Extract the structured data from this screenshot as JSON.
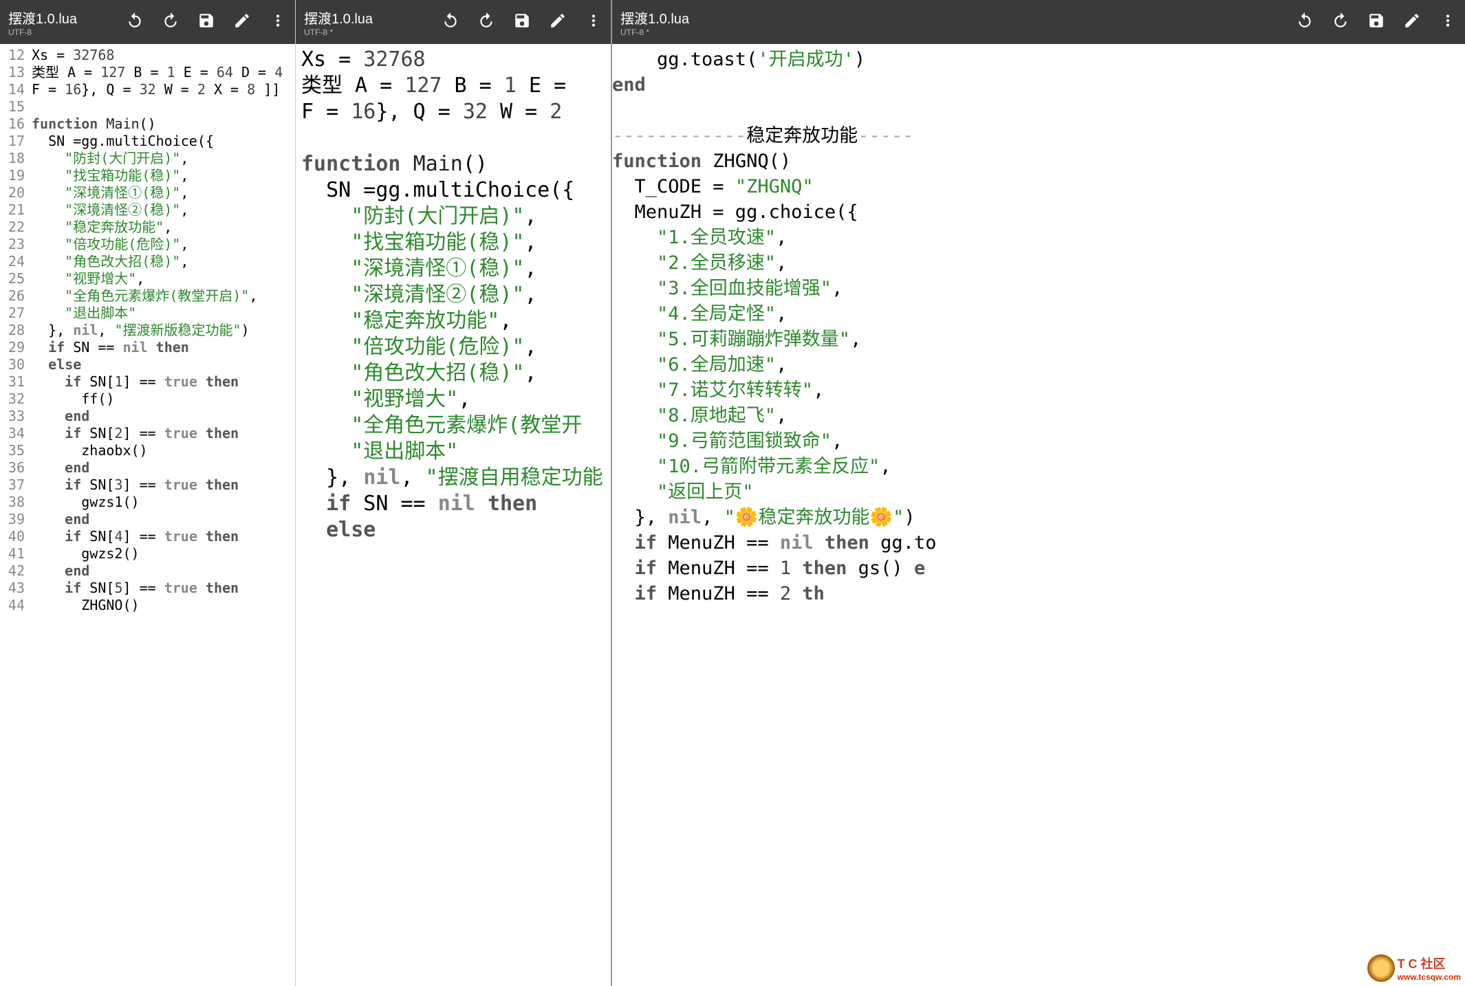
{
  "toolbar1": {
    "filename": "摆渡1.0.lua",
    "encoding": "UTF-8"
  },
  "toolbar2": {
    "filename": "摆渡1.0.lua",
    "encoding": "UTF-8 *"
  },
  "toolbar3": {
    "filename": "摆渡1.0.lua",
    "encoding": "UTF-8 *"
  },
  "pane1": {
    "start": 12,
    "lines": [
      {
        "n": "12",
        "html": "Xs = <span class='num'>32768</span>"
      },
      {
        "n": "13",
        "html": "类型 A = <span class='num'>127</span> B = <span class='num'>1</span> E = <span class='num'>64</span> D = <span class='num'>4</span>"
      },
      {
        "n": "14",
        "html": "F = <span class='num'>16</span>}, Q = <span class='num'>32</span> W = <span class='num'>2</span> X = <span class='num'>8</span> ]]"
      },
      {
        "n": "15",
        "html": ""
      },
      {
        "n": "16",
        "html": "<span class='kw'>function</span> <span class='fn'>Main</span>()"
      },
      {
        "n": "17",
        "html": "  SN =gg.multiChoice({"
      },
      {
        "n": "18",
        "html": "    <span class='str'>\"防封(大门开启)\"</span>,"
      },
      {
        "n": "19",
        "html": "    <span class='str'>\"找宝箱功能(稳)\"</span>,"
      },
      {
        "n": "20",
        "html": "    <span class='str'>\"深境清怪①(稳)\"</span>,"
      },
      {
        "n": "21",
        "html": "    <span class='str'>\"深境清怪②(稳)\"</span>,"
      },
      {
        "n": "22",
        "html": "    <span class='str'>\"稳定奔放功能\"</span>,"
      },
      {
        "n": "23",
        "html": "    <span class='str'>\"倍攻功能(危险)\"</span>,"
      },
      {
        "n": "24",
        "html": "    <span class='str'>\"角色改大招(稳)\"</span>,"
      },
      {
        "n": "25",
        "html": "    <span class='str'>\"视野增大\"</span>,"
      },
      {
        "n": "26",
        "html": "    <span class='str'>\"全角色元素爆炸(教堂开启)\"</span>,"
      },
      {
        "n": "27",
        "html": "    <span class='str'>\"退出脚本\"</span>"
      },
      {
        "n": "28",
        "html": "  }, <span class='nil'>nil</span>, <span class='str'>\"摆渡新版稳定功能\"</span>)"
      },
      {
        "n": "29",
        "html": "  <span class='kw'>if</span> SN == <span class='nil'>nil</span> <span class='kw'>then</span>"
      },
      {
        "n": "30",
        "html": "  <span class='kw'>else</span>"
      },
      {
        "n": "31",
        "html": "    <span class='kw'>if</span> SN[<span class='num'>1</span>] == <span class='bool'>true</span> <span class='kw'>then</span>"
      },
      {
        "n": "32",
        "html": "      ff()"
      },
      {
        "n": "33",
        "html": "    <span class='kw'>end</span>"
      },
      {
        "n": "34",
        "html": "    <span class='kw'>if</span> SN[<span class='num'>2</span>] == <span class='bool'>true</span> <span class='kw'>then</span>"
      },
      {
        "n": "35",
        "html": "      zhaobx()"
      },
      {
        "n": "36",
        "html": "    <span class='kw'>end</span>"
      },
      {
        "n": "37",
        "html": "    <span class='kw'>if</span> SN[<span class='num'>3</span>] == <span class='bool'>true</span> <span class='kw'>then</span>"
      },
      {
        "n": "38",
        "html": "      gwzs1()"
      },
      {
        "n": "39",
        "html": "    <span class='kw'>end</span>"
      },
      {
        "n": "40",
        "html": "    <span class='kw'>if</span> SN[<span class='num'>4</span>] == <span class='bool'>true</span> <span class='kw'>then</span>"
      },
      {
        "n": "41",
        "html": "      gwzs2()"
      },
      {
        "n": "42",
        "html": "    <span class='kw'>end</span>"
      },
      {
        "n": "43",
        "html": "    <span class='kw'>if</span> SN[<span class='num'>5</span>] == <span class='bool'>true</span> <span class='kw'>then</span>"
      },
      {
        "n": "44",
        "html": "      ZHGNO()"
      }
    ]
  },
  "pane2": {
    "lines": [
      {
        "html": "Xs = <span class='num'>32768</span>"
      },
      {
        "html": "类型 A = <span class='num'>127</span> B = <span class='num'>1</span> E ="
      },
      {
        "html": "F = <span class='num'>16</span>}, Q = <span class='num'>32</span> W = <span class='num'>2</span>"
      },
      {
        "html": ""
      },
      {
        "html": "<span class='kw'>function</span> <span class='fn'>Main</span>()"
      },
      {
        "html": "  SN =gg.multiChoice({"
      },
      {
        "html": "    <span class='str'>\"防封(大门开启)\"</span>,"
      },
      {
        "html": "    <span class='str'>\"找宝箱功能(稳)\"</span>,"
      },
      {
        "html": "    <span class='str'>\"深境清怪①(稳)\"</span>,"
      },
      {
        "html": "    <span class='str'>\"深境清怪②(稳)\"</span>,"
      },
      {
        "html": "    <span class='str'>\"稳定奔放功能\"</span>,"
      },
      {
        "html": "    <span class='str'>\"倍攻功能(危险)\"</span>,"
      },
      {
        "html": "    <span class='str'>\"角色改大招(稳)\"</span>,"
      },
      {
        "html": "    <span class='str'>\"视野增大\"</span>,"
      },
      {
        "html": "    <span class='str'>\"全角色元素爆炸(教堂开</span>"
      },
      {
        "html": "    <span class='str'>\"退出脚本\"</span>"
      },
      {
        "html": "  }, <span class='nil'>nil</span>, <span class='str'>\"摆渡自用稳定功能</span>"
      },
      {
        "html": "  <span class='kw'>if</span> SN == <span class='nil'>nil</span> <span class='kw'>then</span>"
      },
      {
        "html": "  <span class='kw'>else</span>"
      }
    ]
  },
  "pane3": {
    "lines": [
      {
        "html": "    gg.toast(<span class='str'>'开启成功'</span>)"
      },
      {
        "html": "<span class='kw'>end</span>"
      },
      {
        "html": ""
      },
      {
        "html": "<span class='dash'>------------</span>稳定奔放功能<span class='dash'>-----</span>"
      },
      {
        "html": "<span class='kw'>function</span> ZHGNQ()"
      },
      {
        "html": "  T_CODE = <span class='str'>\"ZHGNQ\"</span>"
      },
      {
        "html": "  MenuZH = gg.choice({"
      },
      {
        "html": "    <span class='str'>\"1.全员攻速\"</span>,"
      },
      {
        "html": "    <span class='str'>\"2.全员移速\"</span>,"
      },
      {
        "html": "    <span class='str'>\"3.全回血技能增强\"</span>,"
      },
      {
        "html": "    <span class='str'>\"4.全局定怪\"</span>,"
      },
      {
        "html": "    <span class='str'>\"5.可莉蹦蹦炸弹数量\"</span>,"
      },
      {
        "html": "    <span class='str'>\"6.全局加速\"</span>,"
      },
      {
        "html": "    <span class='str'>\"7.诺艾尔转转转\"</span>,"
      },
      {
        "html": "    <span class='str'>\"8.原地起飞\"</span>,"
      },
      {
        "html": "    <span class='str'>\"9.弓箭范围锁致命\"</span>,"
      },
      {
        "html": "    <span class='str'>\"10.弓箭附带元素全反应\"</span>,"
      },
      {
        "html": "    <span class='str'>\"返回上页\"</span>"
      },
      {
        "html": "  }, <span class='nil'>nil</span>, <span class='str'>\"🌼稳定奔放功能🌼\"</span>)"
      },
      {
        "html": "  <span class='kw'>if</span> MenuZH == <span class='nil'>nil</span> <span class='kw'>then</span> gg.to"
      },
      {
        "html": "  <span class='kw'>if</span> MenuZH == <span class='num'>1</span> <span class='kw'>then</span> gs() <span class='kw'>e</span>"
      },
      {
        "html": "  <span class='kw'>if</span> MenuZH == <span class='num'>2</span> <span class='kw'>th</span>"
      }
    ]
  },
  "watermark": {
    "text1": "T C 社区",
    "text2": "www.tcsqw.com"
  }
}
